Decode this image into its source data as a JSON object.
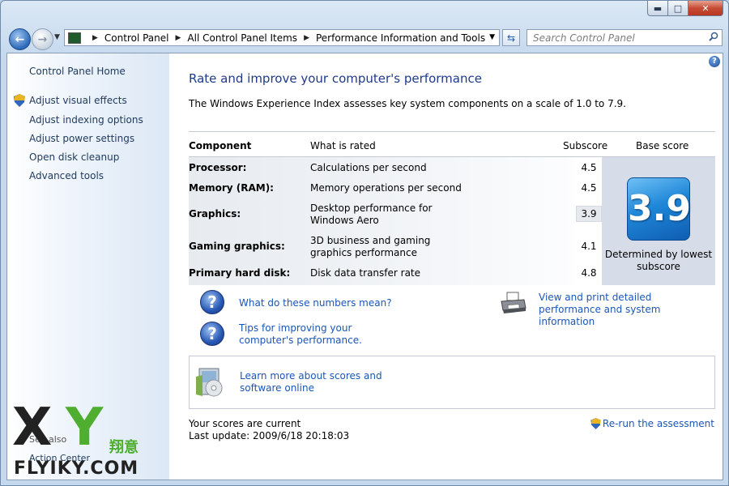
{
  "window": {
    "minimize_glyph": "▬",
    "maximize_glyph": "□",
    "close_glyph": "✕"
  },
  "nav": {
    "back_glyph": "←",
    "forward_glyph": "→",
    "dropdown_glyph": "▼"
  },
  "address": {
    "breadcrumbs": [
      "Control Panel",
      "All Control Panel Items",
      "Performance Information and Tools"
    ],
    "separator": "▶",
    "dropdown_glyph": "▼",
    "refresh_glyph": "⇆"
  },
  "search": {
    "placeholder": "Search Control Panel",
    "icon": "search-icon"
  },
  "sidebar": {
    "home": "Control Panel Home",
    "items": [
      "Adjust visual effects",
      "Adjust indexing options",
      "Adjust power settings",
      "Open disk cleanup",
      "Advanced tools"
    ],
    "see_also": "See also",
    "action_center": "Action Center"
  },
  "main": {
    "help_glyph": "?",
    "title": "Rate and improve your computer's performance",
    "intro": "The Windows Experience Index assesses key system components on a scale of 1.0 to 7.9.",
    "table": {
      "headers": {
        "component": "Component",
        "rated": "What is rated",
        "subscore": "Subscore",
        "base": "Base score"
      },
      "rows": [
        {
          "component": "Processor:",
          "rated": "Calculations per second",
          "subscore": "4.5"
        },
        {
          "component": "Memory (RAM):",
          "rated": "Memory operations per second",
          "subscore": "4.5"
        },
        {
          "component": "Graphics:",
          "rated": "Desktop performance for Windows Aero",
          "subscore": "3.9"
        },
        {
          "component": "Gaming graphics:",
          "rated": "3D business and gaming graphics performance",
          "subscore": "4.1"
        },
        {
          "component": "Primary hard disk:",
          "rated": "Disk data transfer rate",
          "subscore": "4.8"
        }
      ],
      "base_score": "3.9",
      "base_caption": "Determined by lowest subscore"
    },
    "links": {
      "numbers": "What do these numbers mean?",
      "tips": "Tips for improving your computer's performance.",
      "print": "View and print detailed performance and system information",
      "learn": "Learn more about scores and software online"
    },
    "question_glyph": "?",
    "status_current": "Your scores are current",
    "status_update": "Last update: 2009/6/18 20:18:03",
    "rerun": "Re-run the assessment"
  },
  "watermark": {
    "letter_x": "X",
    "letter_y": "Y",
    "cn": "翔意",
    "url": "FLYIKY.COM"
  },
  "colors": {
    "link": "#1a56b8",
    "title": "#1e3a8c",
    "sidebar_text": "#1e395b",
    "score_tile": "#1f87d8",
    "watermark_green": "#4fae2f"
  }
}
